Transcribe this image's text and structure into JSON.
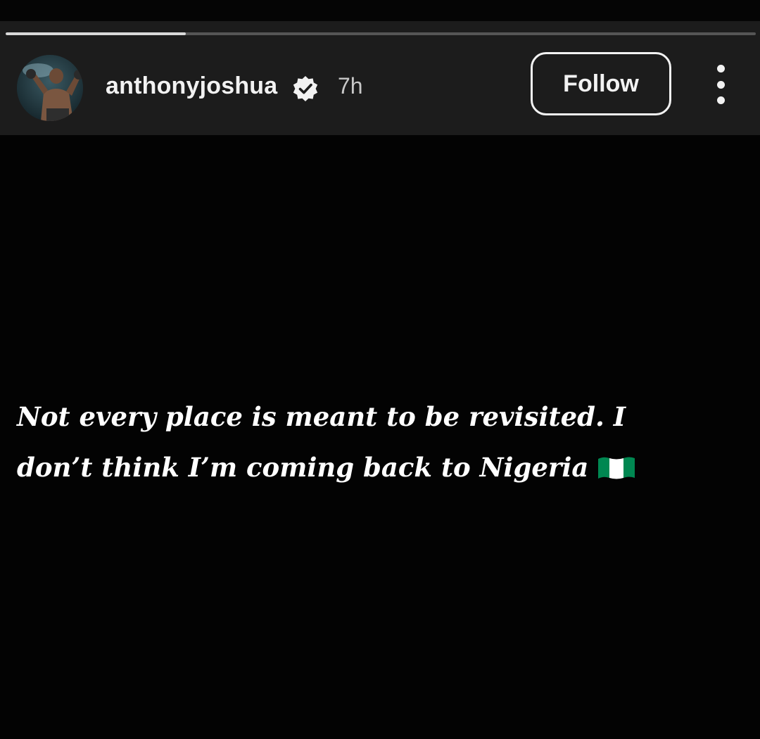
{
  "story": {
    "progress": 0.24,
    "user": {
      "username": "anthonyjoshua",
      "verified": true,
      "posted_ago": "7h"
    },
    "actions": {
      "follow_label": "Follow"
    },
    "text_line_1": "Not every place is meant to be revisited. I",
    "text_line_2": "don’t think I’m coming back to Nigeria"
  },
  "icons": {
    "verified": "verified-badge-icon",
    "more": "more-options-icon",
    "flag": "nigeria-flag-icon"
  },
  "colors": {
    "header_bg": "#1c1c1c",
    "background": "#000000",
    "text": "#ffffff",
    "flag_green": "#008751",
    "flag_white": "#ffffff"
  }
}
